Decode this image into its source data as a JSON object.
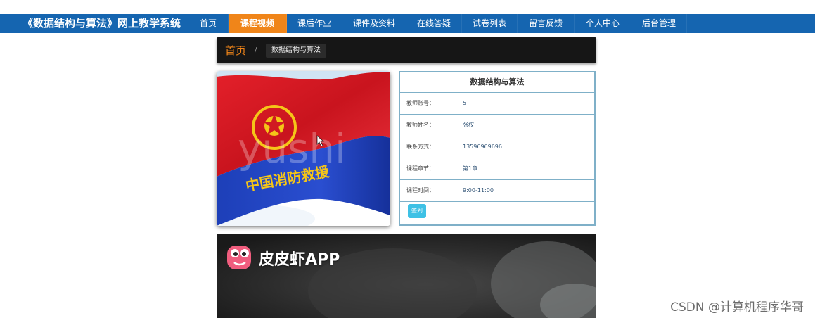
{
  "site": {
    "title": "《数据结构与算法》网上教学系统"
  },
  "nav": {
    "items": [
      {
        "label": "首页",
        "width": 56
      },
      {
        "label": "课程视频",
        "width": 82
      },
      {
        "label": "课后作业",
        "width": 78
      },
      {
        "label": "课件及资料",
        "width": 90
      },
      {
        "label": "在线答疑",
        "width": 78
      },
      {
        "label": "试卷列表",
        "width": 78
      },
      {
        "label": "留言反馈",
        "width": 80
      },
      {
        "label": "个人中心",
        "width": 80
      },
      {
        "label": "后台管理",
        "width": 78
      }
    ],
    "active": "课程视频"
  },
  "breadcrumb": {
    "home": "首页",
    "separator": "/",
    "current": "数据结构与算法"
  },
  "course": {
    "title": "数据结构与算法",
    "rows": [
      {
        "key": "教师账号：",
        "value": "5"
      },
      {
        "key": "教师姓名：",
        "value": "张权"
      },
      {
        "key": "联系方式：",
        "value": "13596969696"
      },
      {
        "key": "课程章节：",
        "value": "第1章"
      },
      {
        "key": "课程时间：",
        "value": "9:00-11:00"
      }
    ],
    "signin_label": "签到"
  },
  "cover": {
    "overlay_text": "yushi",
    "banner_text": "中国消防救援"
  },
  "video": {
    "app_label": "皮皮虾APP"
  },
  "watermark": "CSDN @计算机程序华哥",
  "colors": {
    "nav_bg": "#1565b0",
    "nav_active": "#f08519",
    "panel_border": "#7fb0c8",
    "signin": "#3ec1e5"
  }
}
